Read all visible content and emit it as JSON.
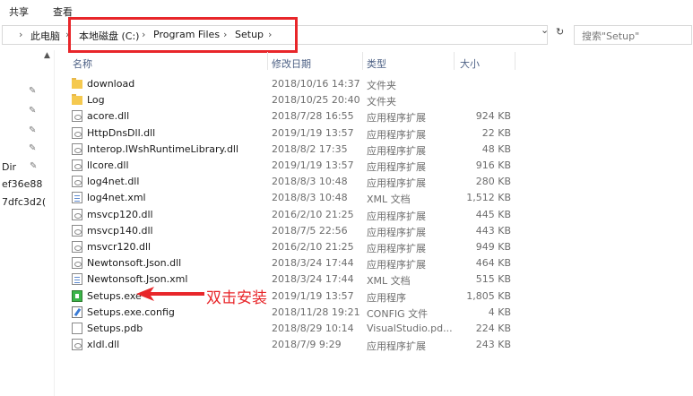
{
  "ribbon": {
    "share": "共享",
    "view": "查看"
  },
  "address": {
    "pc": "此电脑",
    "drive": "本地磁盘 (C:)",
    "folder1": "Program Files",
    "folder2": "Setup",
    "sep": "›",
    "dropdown": "⌄",
    "refresh": "↻"
  },
  "search": {
    "placeholder": "搜索\"Setup\""
  },
  "nav": {
    "items": [
      "Dir",
      "ef36e88",
      "7dfc3d2("
    ]
  },
  "columns": {
    "name": "名称",
    "date": "修改日期",
    "type": "类型",
    "size": "大小"
  },
  "files": [
    {
      "icon": "folder-icon",
      "name": "download",
      "date": "2018/10/16 14:37",
      "type": "文件夹",
      "size": ""
    },
    {
      "icon": "folder-icon",
      "name": "Log",
      "date": "2018/10/25 20:40",
      "type": "文件夹",
      "size": ""
    },
    {
      "icon": "dll-file-icon",
      "name": "acore.dll",
      "date": "2018/7/28 16:55",
      "type": "应用程序扩展",
      "size": "924 KB"
    },
    {
      "icon": "dll-file-icon",
      "name": "HttpDnsDll.dll",
      "date": "2019/1/19 13:57",
      "type": "应用程序扩展",
      "size": "22 KB"
    },
    {
      "icon": "dll-file-icon",
      "name": "Interop.IWshRuntimeLibrary.dll",
      "date": "2018/8/2 17:35",
      "type": "应用程序扩展",
      "size": "48 KB"
    },
    {
      "icon": "dll-file-icon",
      "name": "llcore.dll",
      "date": "2019/1/19 13:57",
      "type": "应用程序扩展",
      "size": "916 KB"
    },
    {
      "icon": "dll-file-icon",
      "name": "log4net.dll",
      "date": "2018/8/3 10:48",
      "type": "应用程序扩展",
      "size": "280 KB"
    },
    {
      "icon": "xml-file-icon",
      "name": "log4net.xml",
      "date": "2018/8/3 10:48",
      "type": "XML 文档",
      "size": "1,512 KB"
    },
    {
      "icon": "dll-file-icon",
      "name": "msvcp120.dll",
      "date": "2016/2/10 21:25",
      "type": "应用程序扩展",
      "size": "445 KB"
    },
    {
      "icon": "dll-file-icon",
      "name": "msvcp140.dll",
      "date": "2018/7/5 22:56",
      "type": "应用程序扩展",
      "size": "443 KB"
    },
    {
      "icon": "dll-file-icon",
      "name": "msvcr120.dll",
      "date": "2016/2/10 21:25",
      "type": "应用程序扩展",
      "size": "949 KB"
    },
    {
      "icon": "dll-file-icon",
      "name": "Newtonsoft.Json.dll",
      "date": "2018/3/24 17:44",
      "type": "应用程序扩展",
      "size": "464 KB"
    },
    {
      "icon": "xml-file-icon",
      "name": "Newtonsoft.Json.xml",
      "date": "2018/3/24 17:44",
      "type": "XML 文档",
      "size": "515 KB"
    },
    {
      "icon": "exe-file-icon",
      "name": "Setups.exe",
      "date": "2019/1/19 13:57",
      "type": "应用程序",
      "size": "1,805 KB"
    },
    {
      "icon": "config-file-icon",
      "name": "Setups.exe.config",
      "date": "2018/11/28 19:21",
      "type": "CONFIG 文件",
      "size": "4 KB"
    },
    {
      "icon": "pdb-file-icon",
      "name": "Setups.pdb",
      "date": "2018/8/29 10:14",
      "type": "VisualStudio.pd...",
      "size": "224 KB"
    },
    {
      "icon": "dll-file-icon",
      "name": "xldl.dll",
      "date": "2018/7/9 9:29",
      "type": "应用程序扩展",
      "size": "243 KB"
    }
  ],
  "annotation": {
    "text": "双击安装",
    "color": "#e8262a"
  },
  "colors": {
    "highlight": "#e8262a",
    "header_text": "#4d6185",
    "folder": "#f5c94f"
  }
}
